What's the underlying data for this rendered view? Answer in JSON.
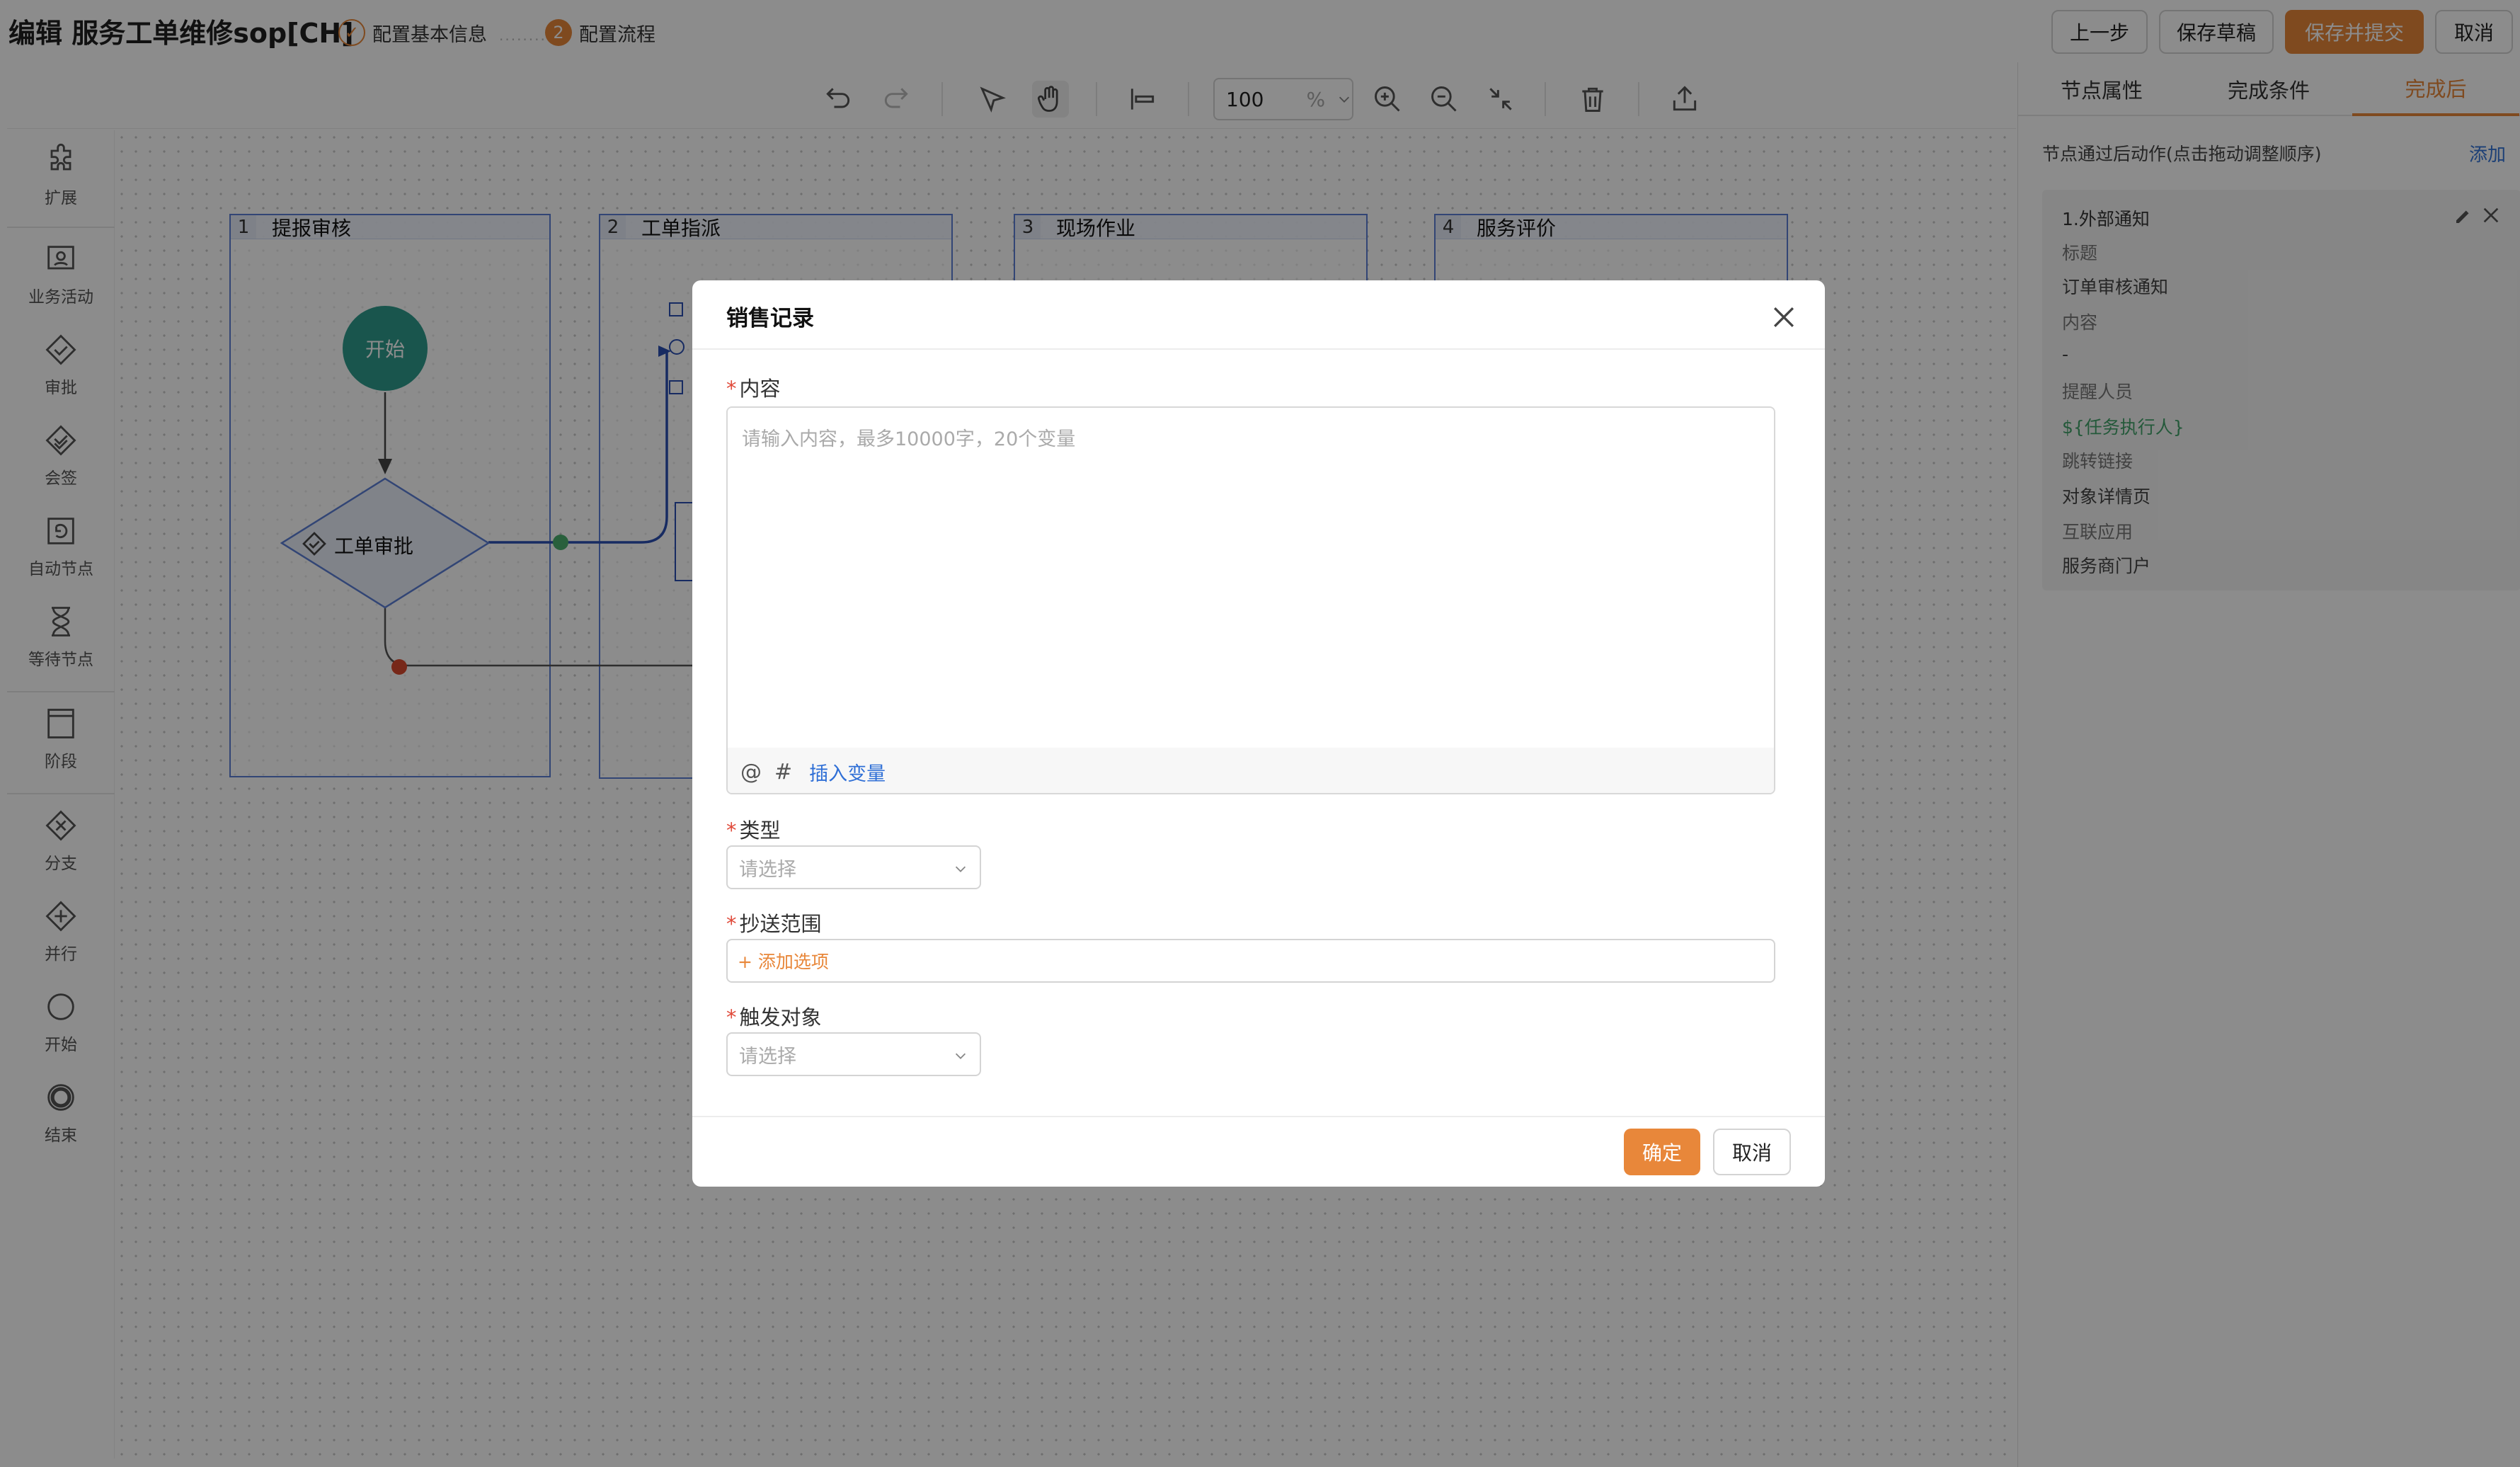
{
  "header": {
    "title": "编辑 服务工单维修sop[CH]",
    "steps": [
      {
        "index": "✓",
        "label": "配置基本信息"
      },
      {
        "index": "2",
        "label": "配置流程"
      }
    ],
    "buttons": {
      "prev": "上一步",
      "save_draft": "保存草稿",
      "save_submit": "保存并提交",
      "cancel": "取消"
    }
  },
  "toolbar": {
    "zoom_value": "100",
    "zoom_unit": "%"
  },
  "palette": [
    {
      "label": "扩展",
      "icon": "puzzle-icon"
    },
    {
      "label": "业务活动",
      "icon": "business-activity-icon"
    },
    {
      "label": "审批",
      "icon": "approval-icon"
    },
    {
      "label": "会签",
      "icon": "countersign-icon"
    },
    {
      "label": "自动节点",
      "icon": "auto-node-icon"
    },
    {
      "label": "等待节点",
      "icon": "hourglass-icon"
    },
    {
      "label": "阶段",
      "icon": "stage-icon"
    },
    {
      "label": "分支",
      "icon": "branch-icon"
    },
    {
      "label": "并行",
      "icon": "parallel-icon"
    },
    {
      "label": "开始",
      "icon": "start-icon"
    },
    {
      "label": "结束",
      "icon": "end-icon"
    }
  ],
  "lanes": [
    {
      "num": "1",
      "title": "提报审核"
    },
    {
      "num": "2",
      "title": "工单指派"
    },
    {
      "num": "3",
      "title": "现场作业"
    },
    {
      "num": "4",
      "title": "服务评价"
    }
  ],
  "flow": {
    "start_label": "开始",
    "approval_label": "工单审批"
  },
  "right_panel": {
    "tabs": [
      "节点属性",
      "完成条件",
      "完成后"
    ],
    "description": "节点通过后动作(点击拖动调整顺序)",
    "add_label": "添加",
    "action": {
      "title": "1.外部通知",
      "title_label": "标题",
      "title_value": "订单审核通知",
      "content_label": "内容",
      "content_value": "-",
      "reminder_label": "提醒人员",
      "reminder_value": "${任务执行人}",
      "link_label": "跳转链接",
      "link_value": "对象详情页",
      "app_label": "互联应用",
      "app_value": "服务商门户"
    }
  },
  "modal": {
    "title": "销售记录",
    "content_label": "内容",
    "content_placeholder": "请输入内容，最多10000字，20个变量",
    "insert_variable": "插入变量",
    "at_symbol": "@",
    "hash_symbol": "#",
    "type_label": "类型",
    "type_placeholder": "请选择",
    "cc_label": "抄送范围",
    "cc_add": "+ 添加选项",
    "trigger_label": "触发对象",
    "trigger_placeholder": "请选择",
    "ok": "确定",
    "cancel": "取消"
  },
  "colors": {
    "accent": "#e8873a",
    "link": "#2f6fd6",
    "lane_border": "#5b7fd6",
    "start_node": "#2f9c8c",
    "required": "#e04a3a"
  }
}
